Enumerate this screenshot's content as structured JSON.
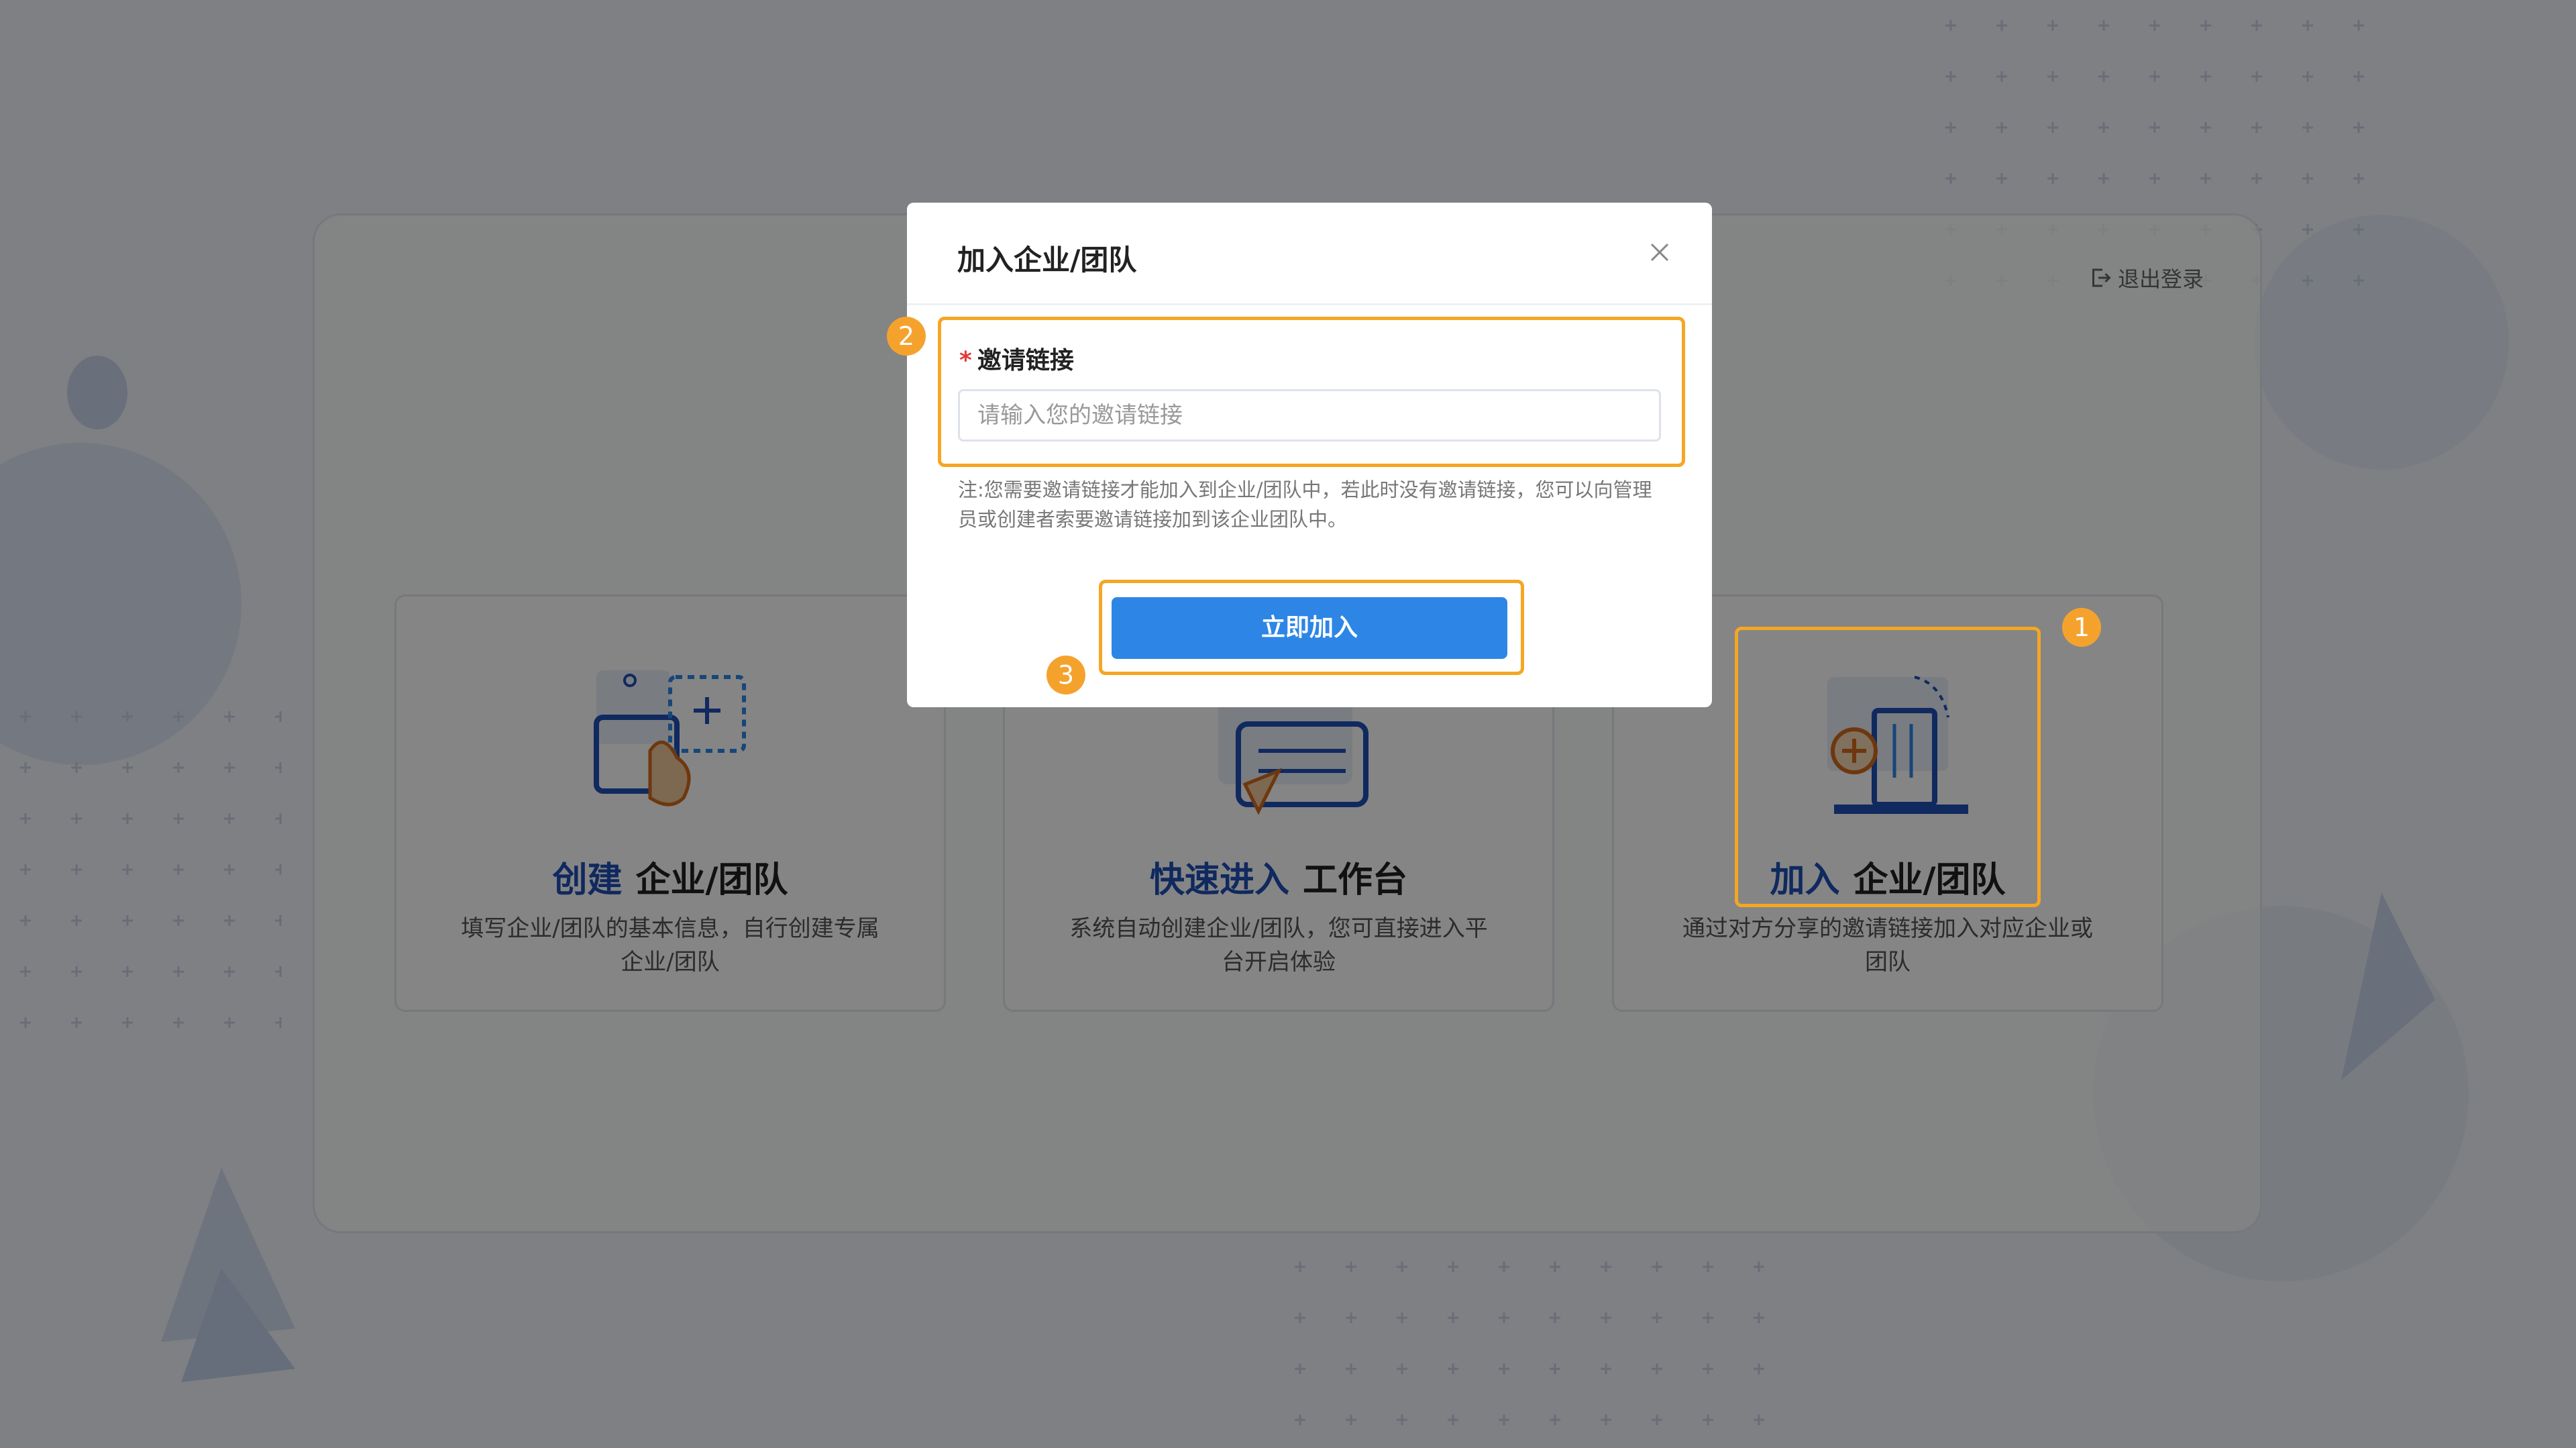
{
  "logout": {
    "label": "退出登录",
    "icon": "logout-icon"
  },
  "cards": [
    {
      "highlight": "创建",
      "title": "企业/团队",
      "desc": "填写企业/团队的基本信息，自行创建专属企业/团队",
      "icon": "create-illustration"
    },
    {
      "highlight": "快速进入",
      "title": "工作台",
      "desc": "系统自动创建企业/团队，您可直接进入平台开启体验",
      "icon": "quick-enter-illustration"
    },
    {
      "highlight": "加入",
      "title": "企业/团队",
      "desc": "通过对方分享的邀请链接加入对应企业或团队",
      "icon": "join-illustration"
    }
  ],
  "modal": {
    "title": "加入企业/团队",
    "field_label": "邀请链接",
    "required_mark": "*",
    "field_placeholder": "请输入您的邀请链接",
    "note": "注:您需要邀请链接才能加入到企业/团队中，若此时没有邀请链接，您可以向管理员或创建者索要邀请链接加到该企业团队中。",
    "submit_label": "立即加入",
    "close_icon": "close-icon"
  },
  "annotations": [
    "1",
    "2",
    "3"
  ],
  "colors": {
    "accent": "#2d86e6",
    "highlight_orange": "#f5a623",
    "brand_blue": "#1f4fb6"
  }
}
